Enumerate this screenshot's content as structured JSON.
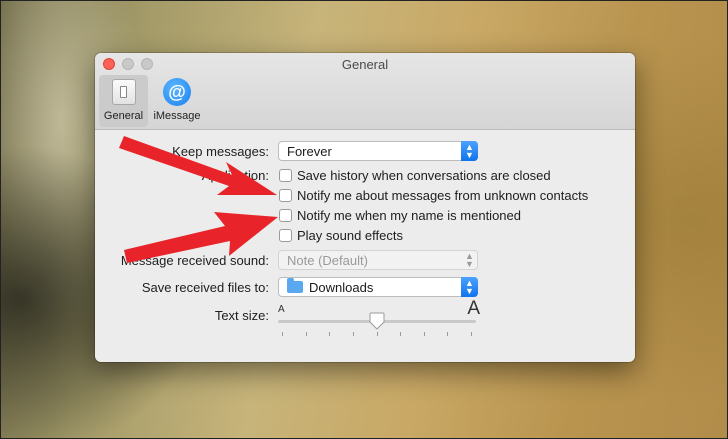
{
  "window": {
    "title": "General"
  },
  "toolbar": {
    "tabs": [
      {
        "label": "General"
      },
      {
        "label": "iMessage"
      }
    ]
  },
  "imessage_icon_glyph": "@",
  "keep_messages": {
    "label": "Keep messages:",
    "value": "Forever"
  },
  "application": {
    "label": "Application:",
    "options": [
      {
        "label": "Save history when conversations are closed",
        "checked": false
      },
      {
        "label": "Notify me about messages from unknown contacts",
        "checked": false
      },
      {
        "label": "Notify me when my name is mentioned",
        "checked": false
      },
      {
        "label": "Play sound effects",
        "checked": false
      }
    ]
  },
  "message_sound": {
    "label": "Message received sound:",
    "value": "Note (Default)",
    "enabled": false
  },
  "save_files": {
    "label": "Save received files to:",
    "value": "Downloads"
  },
  "text_size": {
    "label": "Text size:",
    "small_glyph": "A",
    "large_glyph": "A",
    "level": 0.5,
    "ticks": 9
  },
  "help_glyph": "?",
  "annotation": {
    "arrow_color": "#e8242a"
  },
  "colors": {
    "accent": "#1a7ff0",
    "close": "#fe5f57"
  }
}
